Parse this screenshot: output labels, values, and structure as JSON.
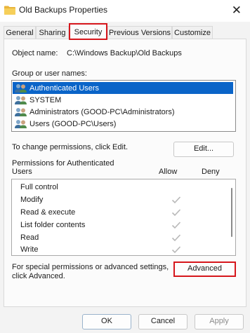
{
  "window": {
    "title": "Old Backups Properties"
  },
  "tabs": [
    {
      "label": "General"
    },
    {
      "label": "Sharing"
    },
    {
      "label": "Security"
    },
    {
      "label": "Previous Versions"
    },
    {
      "label": "Customize"
    }
  ],
  "security": {
    "object_name_label": "Object name:",
    "object_name_value": "C:\\Windows Backup\\Old Backups",
    "group_label": "Group or user names:",
    "users": [
      {
        "name": "Authenticated Users",
        "selected": true
      },
      {
        "name": "SYSTEM",
        "selected": false
      },
      {
        "name": "Administrators (GOOD-PC\\Administrators)",
        "selected": false
      },
      {
        "name": "Users (GOOD-PC\\Users)",
        "selected": false
      }
    ],
    "change_text": "To change permissions, click Edit.",
    "edit_button": "Edit...",
    "perms_header_line1": "Permissions for Authenticated",
    "perms_header_line2": "Users",
    "allow_label": "Allow",
    "deny_label": "Deny",
    "permissions": [
      {
        "name": "Full control",
        "allow": false,
        "deny": false
      },
      {
        "name": "Modify",
        "allow": true,
        "deny": false
      },
      {
        "name": "Read & execute",
        "allow": true,
        "deny": false
      },
      {
        "name": "List folder contents",
        "allow": true,
        "deny": false
      },
      {
        "name": "Read",
        "allow": true,
        "deny": false
      },
      {
        "name": "Write",
        "allow": true,
        "deny": false
      }
    ],
    "special_text_line1": "For special permissions or advanced settings,",
    "special_text_line2": "click Advanced.",
    "advanced_button": "Advanced"
  },
  "footer": {
    "ok": "OK",
    "cancel": "Cancel",
    "apply": "Apply"
  },
  "colors": {
    "selection": "#0a64c8",
    "highlight_box": "#d6161c",
    "check": "#b9b9b9"
  }
}
